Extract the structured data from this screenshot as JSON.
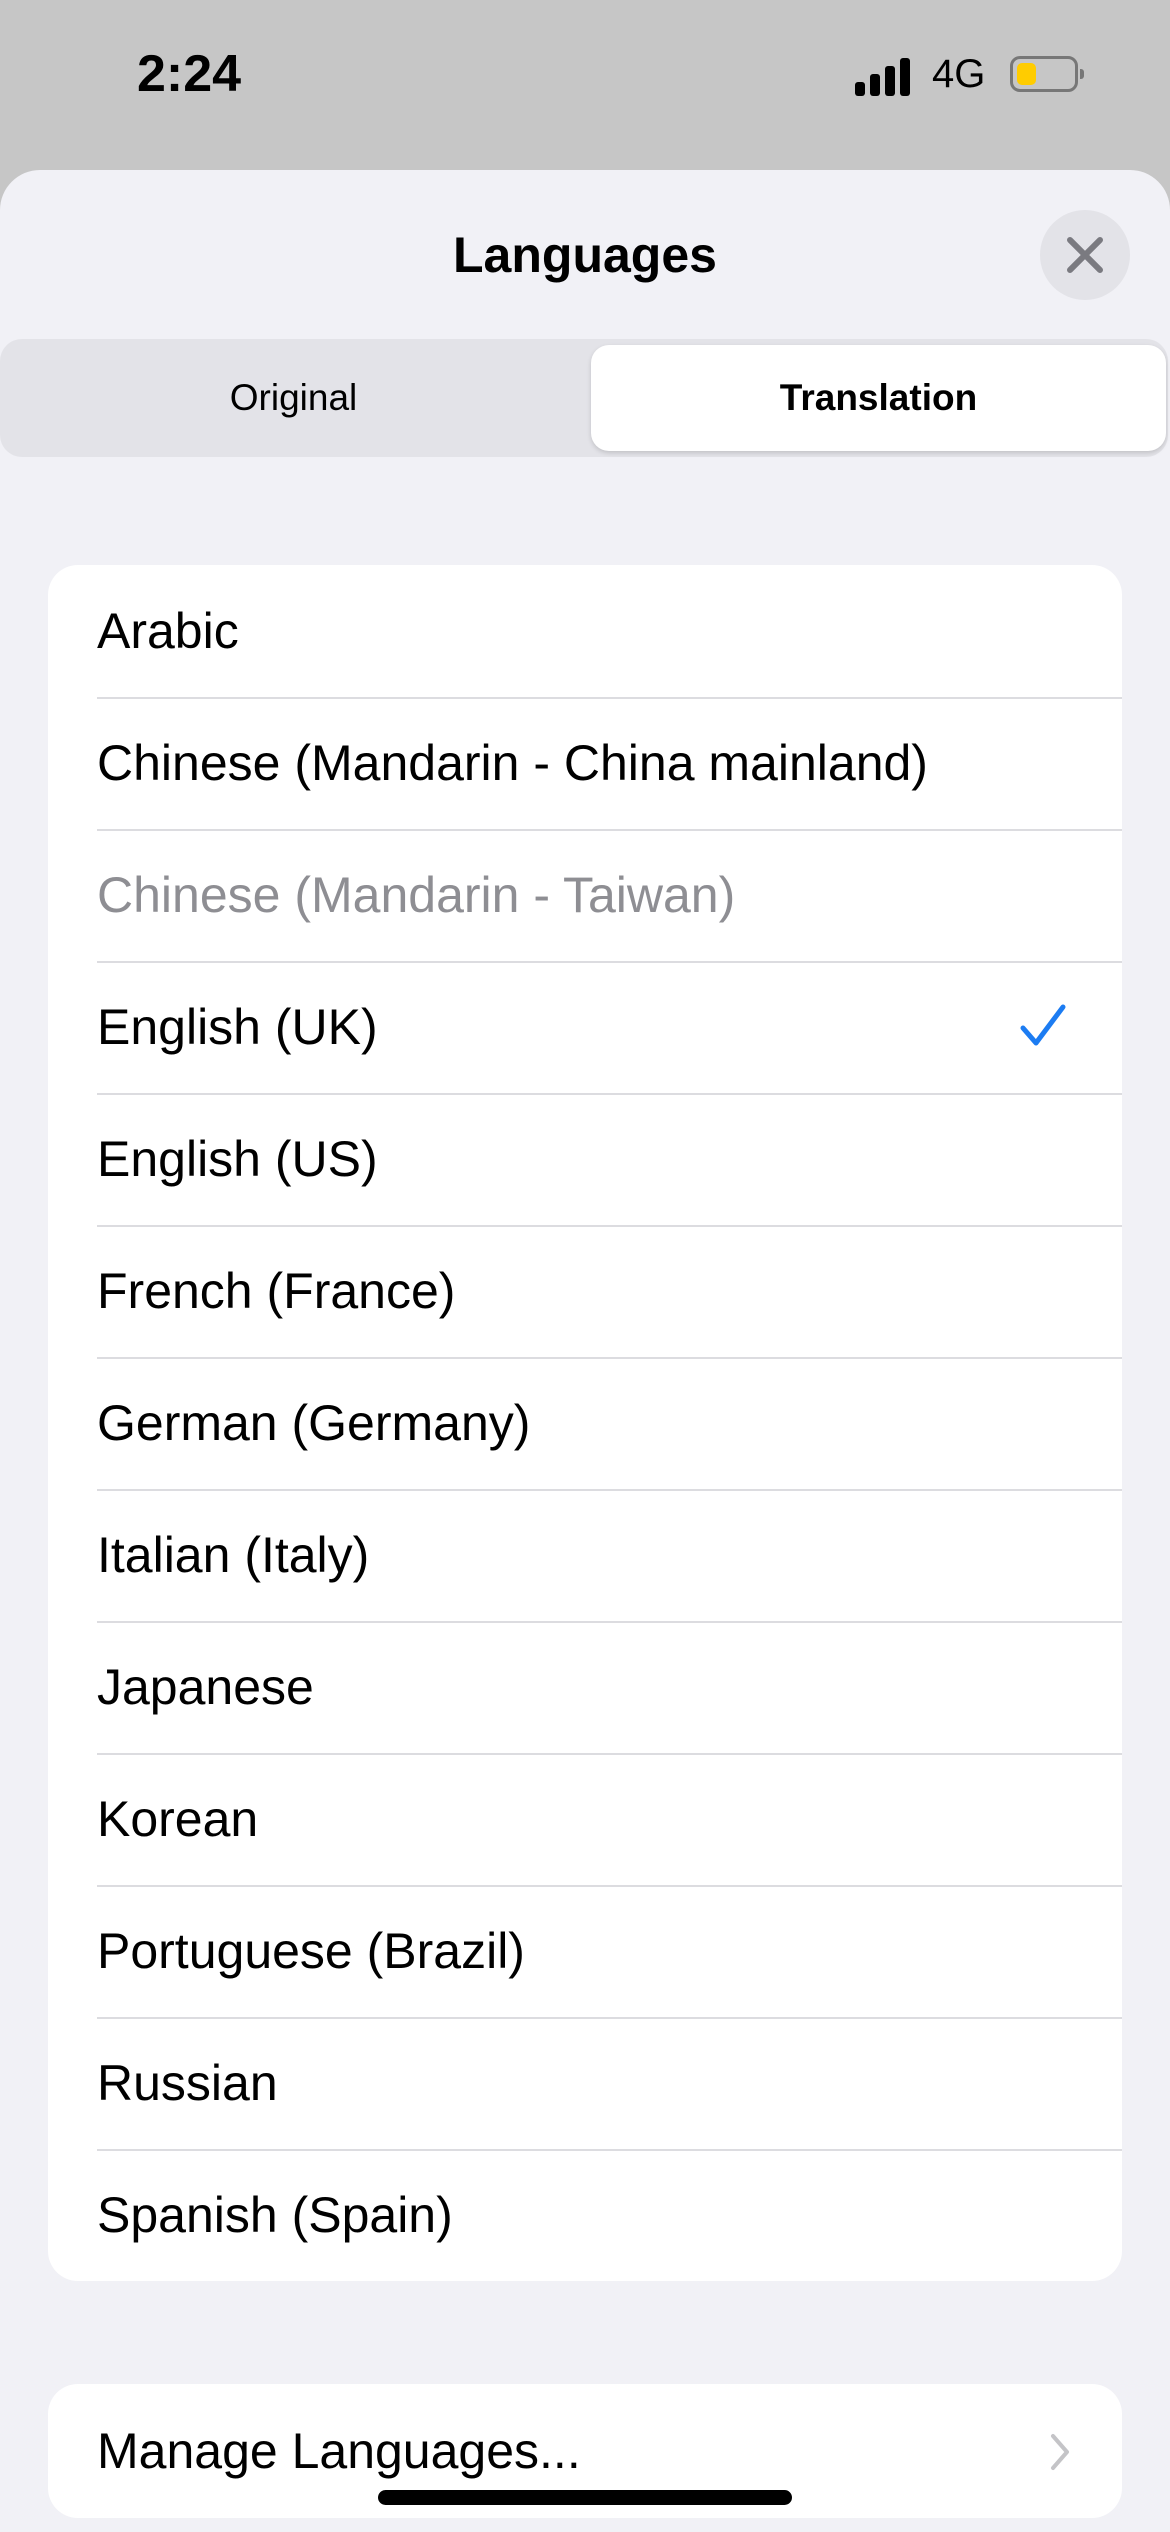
{
  "status_bar": {
    "time": "2:24",
    "network": "4G",
    "battery_level": 0.35,
    "battery_color": "#ffcc00",
    "signal_bars": 4
  },
  "sheet": {
    "title": "Languages",
    "close_icon": "xmark-icon",
    "segments": [
      {
        "label": "Original",
        "selected": false
      },
      {
        "label": "Translation",
        "selected": true
      }
    ],
    "languages": [
      {
        "label": "Arabic"
      },
      {
        "label": "Chinese (Mandarin - China mainland)"
      },
      {
        "label": "Chinese (Mandarin - Taiwan)",
        "disabled": true
      },
      {
        "label": "English (UK)",
        "selected": true
      },
      {
        "label": "English (US)"
      },
      {
        "label": "French (France)"
      },
      {
        "label": "German (Germany)"
      },
      {
        "label": "Italian (Italy)"
      },
      {
        "label": "Japanese"
      },
      {
        "label": "Korean"
      },
      {
        "label": "Portuguese (Brazil)"
      },
      {
        "label": "Russian"
      },
      {
        "label": "Spanish (Spain)"
      }
    ],
    "accent_color": "#1c7cf2",
    "manage_label": "Manage Languages..."
  }
}
